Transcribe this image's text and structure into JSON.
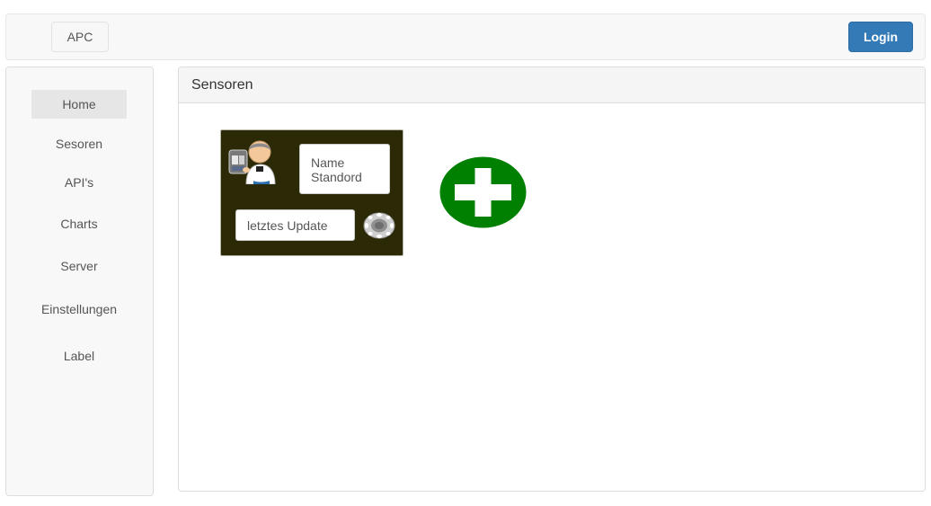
{
  "navbar": {
    "brand": "APC",
    "login": "Login"
  },
  "sidebar": {
    "items": [
      {
        "label": "Home",
        "active": true
      },
      {
        "label": "Sesoren"
      },
      {
        "label": "API's"
      },
      {
        "label": "Charts"
      },
      {
        "label": "Server"
      },
      {
        "label": "Einstellungen"
      },
      {
        "label": "Label"
      }
    ]
  },
  "main": {
    "title": "Sensoren",
    "sensor_card": {
      "name_line1": "Name",
      "name_line2": "Standord",
      "update_label": "letztes Update",
      "avatar_icon": "user-sensor-icon",
      "settings_icon": "gear-icon",
      "background_color": "#2c2a06"
    },
    "add_button": {
      "icon": "plus-icon",
      "color": "#008000"
    }
  },
  "colors": {
    "primary": "#337ab7",
    "add": "#008000"
  }
}
